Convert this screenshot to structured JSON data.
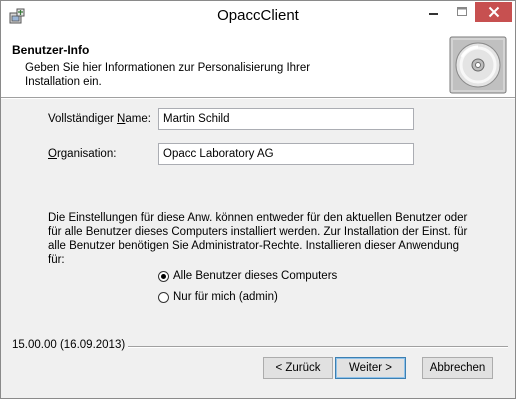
{
  "window": {
    "title": "OpaccClient"
  },
  "header": {
    "title": "Benutzer-Info",
    "description": "Geben Sie hier Informationen zur Personalisierung Ihrer Installation ein."
  },
  "form": {
    "name_label_pre": "Vollständiger ",
    "name_label_u": "N",
    "name_label_post": "ame:",
    "name_value": "Martin Schild",
    "org_label_u": "O",
    "org_label_post": "rganisation:",
    "org_value": "Opacc Laboratory AG"
  },
  "info_text": "Die Einstellungen für diese Anw. können entweder für den aktuellen Benutzer oder für alle Benutzer dieses Computers installiert werden. Zur Installation der Einst. für alle Benutzer benötigen Sie Administrator-Rechte. Installieren dieser Anwendung für:",
  "radios": [
    {
      "label": "Alle Benutzer dieses Computers",
      "selected": true
    },
    {
      "label": "Nur für mich (admin)",
      "selected": false
    }
  ],
  "version": "15.00.00 (16.09.2013)",
  "buttons": {
    "back": "< Zurück",
    "next": "Weiter >",
    "cancel": "Abbrechen"
  },
  "icons": {
    "app": "installer-package-icon",
    "minimize": "minimize-icon",
    "maximize": "maximize-icon",
    "close": "close-icon",
    "header": "cd-disc-icon"
  },
  "colors": {
    "close_button": "#c75050",
    "header_bg": "#ffffff",
    "body_bg": "#f0f0f0"
  }
}
